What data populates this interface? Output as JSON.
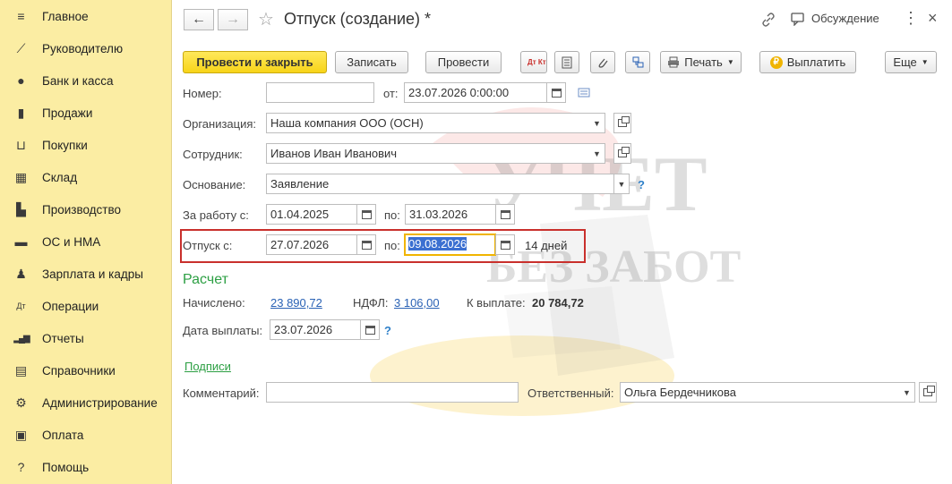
{
  "sidebar": {
    "items": [
      {
        "label": "Главное",
        "icon": "menu-icon",
        "glyph": "≡"
      },
      {
        "label": "Руководителю",
        "icon": "trend-icon",
        "glyph": "⟋"
      },
      {
        "label": "Банк и касса",
        "icon": "coin-icon",
        "glyph": "●"
      },
      {
        "label": "Продажи",
        "icon": "bag-icon",
        "glyph": "▮"
      },
      {
        "label": "Покупки",
        "icon": "cart-icon",
        "glyph": "⊔"
      },
      {
        "label": "Склад",
        "icon": "warehouse-icon",
        "glyph": "▦"
      },
      {
        "label": "Производство",
        "icon": "factory-icon",
        "glyph": "▙"
      },
      {
        "label": "ОС и НМА",
        "icon": "truck-icon",
        "glyph": "▬"
      },
      {
        "label": "Зарплата и кадры",
        "icon": "person-icon",
        "glyph": "♟"
      },
      {
        "label": "Операции",
        "icon": "dt-kt-icon",
        "glyph": "Дт"
      },
      {
        "label": "Отчеты",
        "icon": "bar-chart-icon",
        "glyph": "▂▄▆"
      },
      {
        "label": "Справочники",
        "icon": "book-icon",
        "glyph": "▤"
      },
      {
        "label": "Администрирование",
        "icon": "gear-icon",
        "glyph": "⚙"
      },
      {
        "label": "Оплата",
        "icon": "payment-icon",
        "glyph": "▣"
      },
      {
        "label": "Помощь",
        "icon": "help-icon",
        "glyph": "?"
      }
    ]
  },
  "header": {
    "back": "←",
    "forward": "→",
    "star": "☆",
    "title": "Отпуск (создание) *",
    "discussion": "Обсуждение",
    "more": "⋮"
  },
  "toolbar": {
    "post_close": "Провести и закрыть",
    "save": "Записать",
    "post": "Провести",
    "dtkt": "Дт Кт",
    "print": "Печать",
    "pay": "Выплатить",
    "more": "Еще"
  },
  "form": {
    "number_label": "Номер:",
    "number_value": "",
    "from_label": "от:",
    "date_value": "23.07.2026  0:00:00",
    "org_label": "Организация:",
    "org_value": "Наша компания ООО (ОСН)",
    "emp_label": "Сотрудник:",
    "emp_value": "Иванов Иван Иванович",
    "basis_label": "Основание:",
    "basis_value": "Заявление",
    "work_label": "За работу с:",
    "work_from": "01.04.2025",
    "to_label": "по:",
    "work_to": "31.03.2026",
    "vac_label": "Отпуск с:",
    "vac_from": "27.07.2026",
    "vac_to": "09.08.2026",
    "days": "14 дней",
    "help": "?"
  },
  "calc": {
    "title": "Расчет",
    "accrued_label": "Начислено:",
    "accrued": "23 890,72",
    "ndfl_label": "НДФЛ:",
    "ndfl": "3 106,00",
    "topay_label": "К выплате:",
    "topay": "20 784,72",
    "paydate_label": "Дата выплаты:",
    "paydate": "23.07.2026"
  },
  "footer": {
    "signatures": "Подписи",
    "comment_label": "Комментарий:",
    "comment": "",
    "responsible_label": "Ответственный:",
    "responsible": "Ольга Бердечникова"
  },
  "watermark": {
    "line1": "УЧЕТ",
    "line2": "БЕЗ ЗАБОТ"
  },
  "colors": {
    "sidebar_bg": "#fbeda3",
    "primary_button": "#f7d419",
    "link": "#2a62b5",
    "section_title": "#2c9f43",
    "highlight_box": "#c9302c",
    "selection": "#3b6fd1"
  }
}
